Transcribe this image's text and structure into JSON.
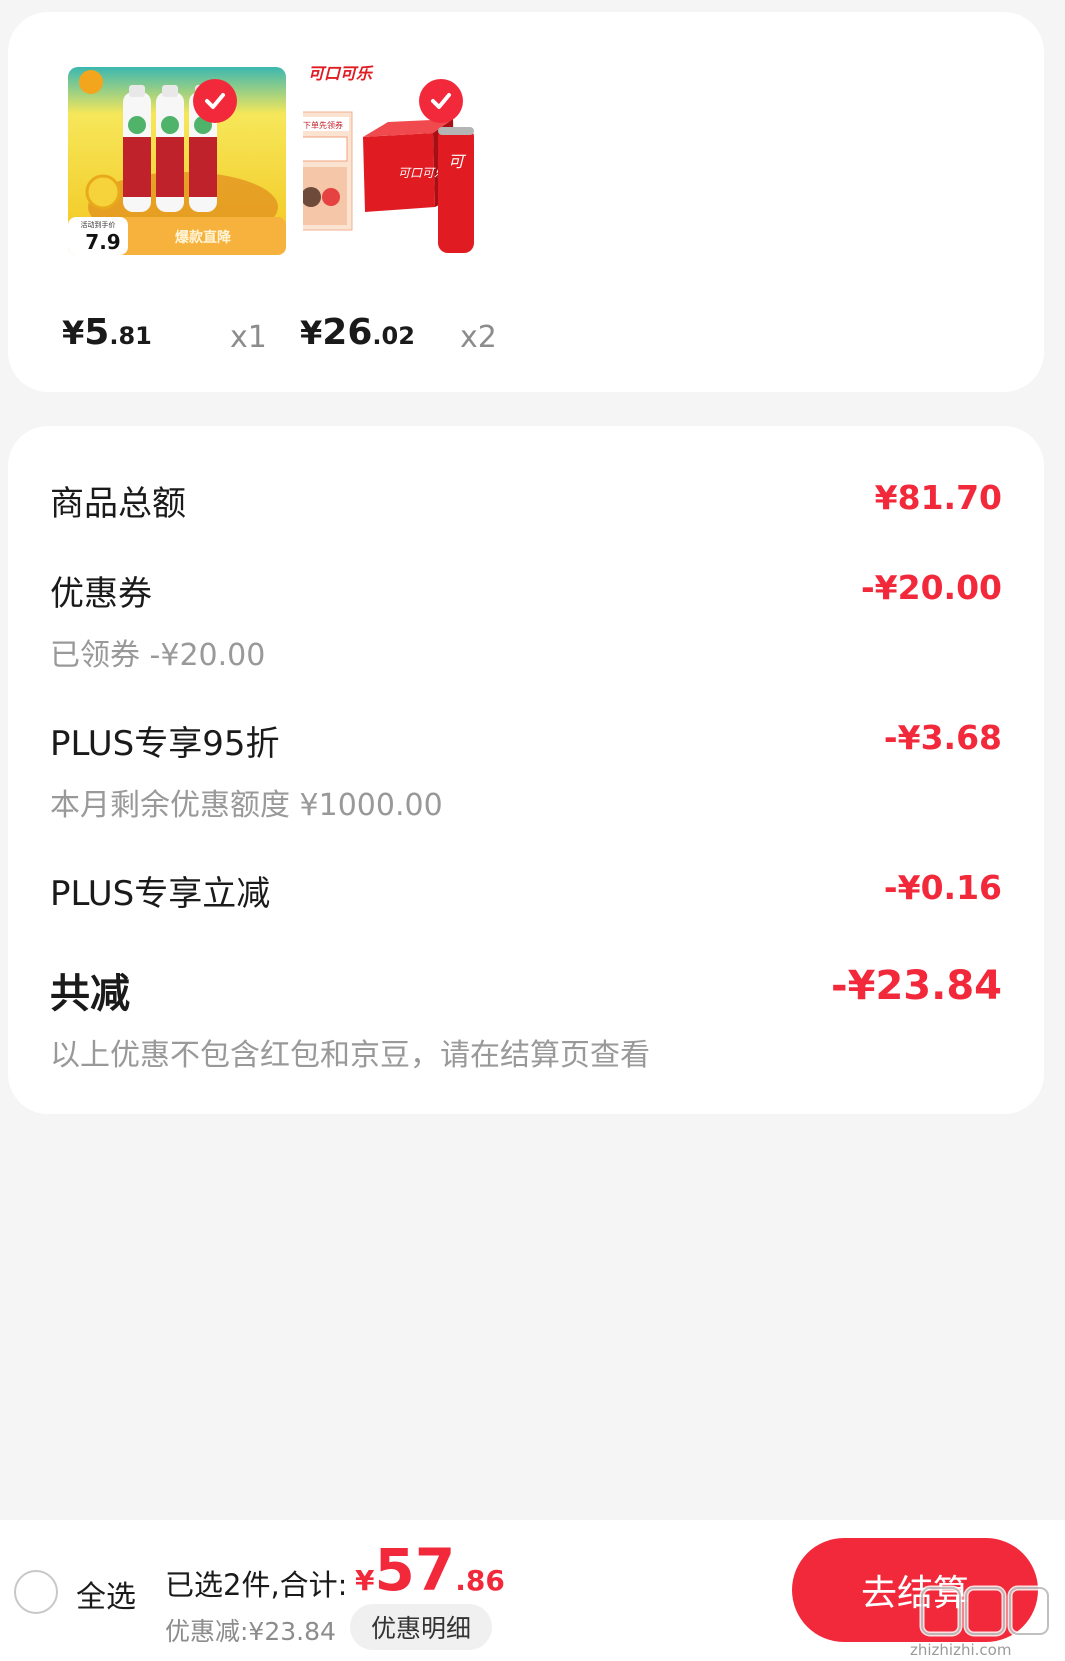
{
  "colors": {
    "accent": "#f2293a",
    "muted": "#999999",
    "background": "#f5f5f5"
  },
  "products": [
    {
      "price_yen": "¥",
      "price_int": "5",
      "price_dec": ".81",
      "qty": "x1",
      "image_text": {
        "badge_price": "7.9",
        "promo": "爆款直降",
        "promo_small": "活动到手价"
      }
    },
    {
      "price_yen": "¥",
      "price_int": "26",
      "price_dec": ".02",
      "qty": "x2",
      "image_text": {
        "brand": "可口可乐",
        "box_title": "下单先领券"
      }
    }
  ],
  "summary": {
    "rows": [
      {
        "label": "商品总额",
        "value": "¥81.70",
        "sub": ""
      },
      {
        "label": "优惠券",
        "value": "-¥20.00",
        "sub": "已领券 -¥20.00"
      },
      {
        "label": "PLUS专享95折",
        "value": "-¥3.68",
        "sub": "本月剩余优惠额度 ¥1000.00"
      },
      {
        "label": "PLUS专享立减",
        "value": "-¥0.16",
        "sub": ""
      }
    ],
    "total_label": "共减",
    "total_value": "-¥23.84",
    "note": "以上优惠不包含红包和京豆，请在结算页查看"
  },
  "bottom_bar": {
    "select_all": "全选",
    "selected_text": "已选2件,合计:",
    "total_yen": "¥",
    "total_int": "57",
    "total_dec": ".86",
    "discount_text": "优惠减:¥23.84",
    "detail_button": "优惠明细",
    "checkout_button": "去结算",
    "watermark": "zhizhizhi.com"
  }
}
